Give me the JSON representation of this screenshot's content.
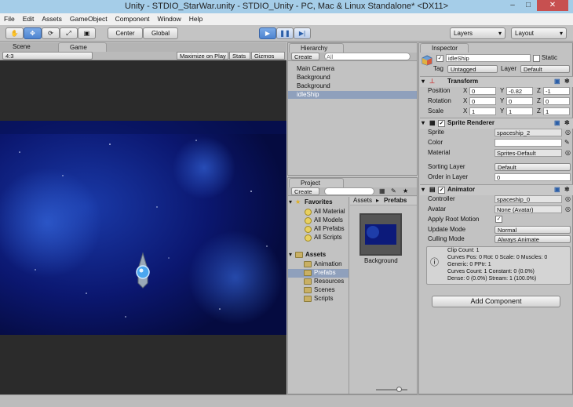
{
  "window": {
    "title": "Unity - STDIO_StarWar.unity - STDIO_Unity - PC, Mac & Linux Standalone* <DX11>",
    "minimize": "–",
    "maximize": "□",
    "close": "✕"
  },
  "menu": [
    "File",
    "Edit",
    "Assets",
    "GameObject",
    "Component",
    "Window",
    "Help"
  ],
  "toolbar": {
    "pivot_label": "Center",
    "space_label": "Global",
    "layers_label": "Layers",
    "layout_label": "Layout"
  },
  "scene_tabs": {
    "scene": "Scene",
    "game": "Game"
  },
  "game_bar": {
    "aspect": "4:3",
    "maximize": "Maximize on Play",
    "stats": "Stats",
    "gizmos": "Gizmos"
  },
  "hierarchy": {
    "title": "Hierarchy",
    "create": "Create",
    "search_placeholder": "All",
    "items": [
      "Main Camera",
      "Background",
      "Background",
      "idleShip"
    ]
  },
  "project": {
    "title": "Project",
    "create": "Create",
    "favorites": {
      "label": "Favorites",
      "items": [
        "All Material",
        "All Models",
        "All Prefabs",
        "All Scripts"
      ]
    },
    "assets": {
      "label": "Assets",
      "items": [
        "Animation",
        "Prefabs",
        "Resources",
        "Scenes",
        "Scripts"
      ]
    },
    "breadcrumb": {
      "root": "Assets",
      "sep": "▸",
      "current": "Prefabs"
    },
    "asset_tile": "Background"
  },
  "inspector": {
    "title": "Inspector",
    "object_name": "idleShip",
    "static_label": "Static",
    "tag_label": "Tag",
    "tag_value": "Untagged",
    "layer_label": "Layer",
    "layer_value": "Default",
    "transform": {
      "title": "Transform",
      "position_label": "Position",
      "position": [
        "0",
        "-0.82",
        "-1"
      ],
      "rotation_label": "Rotation",
      "rotation": [
        "0",
        "0",
        "0"
      ],
      "scale_label": "Scale",
      "scale": [
        "1",
        "1",
        "1"
      ],
      "axes": [
        "X",
        "Y",
        "Z"
      ]
    },
    "sprite_renderer": {
      "title": "Sprite Renderer",
      "sprite_label": "Sprite",
      "sprite_value": "spaceship_2",
      "color_label": "Color",
      "material_label": "Material",
      "material_value": "Sprites-Default",
      "sorting_layer_label": "Sorting Layer",
      "sorting_layer_value": "Default",
      "order_label": "Order in Layer",
      "order_value": "0"
    },
    "animator": {
      "title": "Animator",
      "controller_label": "Controller",
      "controller_value": "spaceship_0",
      "avatar_label": "Avatar",
      "avatar_value": "None (Avatar)",
      "root_motion_label": "Apply Root Motion",
      "update_mode_label": "Update Mode",
      "update_mode_value": "Normal",
      "culling_label": "Culling Mode",
      "culling_value": "Always Animate",
      "info_lines": [
        "Clip Count: 1",
        "Curves Pos: 0 Rot: 0 Scale: 0 Muscles: 0",
        "Generic: 0 PPtr: 1",
        "Curves Count: 1 Constant: 0 (0.0%)",
        "Dense: 0 (0.0%) Stream: 1 (100.0%)"
      ]
    },
    "add_component": "Add Component"
  },
  "colors": {
    "accent": "#4d84d0",
    "selection": "#8fa0bc"
  }
}
